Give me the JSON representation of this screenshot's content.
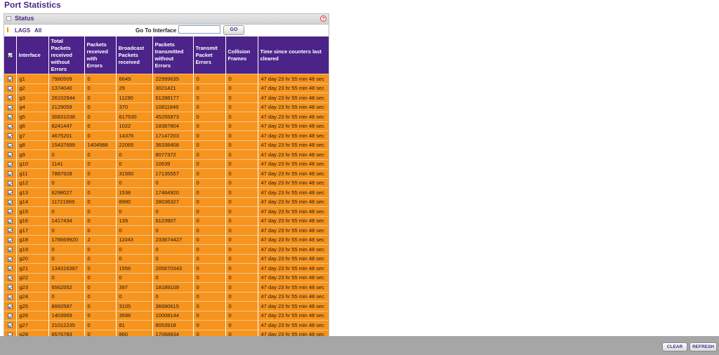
{
  "page": {
    "title": "Port Statistics"
  },
  "panel": {
    "title": "Status",
    "help_symbol": "?"
  },
  "filter": {
    "lags_label": "LAGS",
    "all_label": "All",
    "goto_label": "Go To Interface",
    "goto_value": "",
    "go_button": "GO"
  },
  "table": {
    "columns": [
      "Interface",
      "Total Packets received without Errors",
      "Packets received with Errors",
      "Broadcast Packets received",
      "Packets transmitted without Errors",
      "Transmit Packet Errors",
      "Collision Frames",
      "Time since counters last cleared"
    ],
    "rows": [
      [
        "g1",
        "7980509",
        "0",
        "6649",
        "22999635",
        "0",
        "0",
        "47 day 23 hr 55 min 48 sec"
      ],
      [
        "g2",
        "1374040",
        "0",
        "29",
        "3021421",
        "0",
        "0",
        "47 day 23 hr 55 min 48 sec"
      ],
      [
        "g3",
        "26102944",
        "0",
        "11290",
        "61288177",
        "0",
        "0",
        "47 day 23 hr 55 min 48 sec"
      ],
      [
        "g4",
        "2129059",
        "0",
        "370",
        "10811849",
        "0",
        "0",
        "47 day 23 hr 55 min 48 sec"
      ],
      [
        "g5",
        "30831038",
        "0",
        "617530",
        "45255873",
        "0",
        "0",
        "47 day 23 hr 55 min 48 sec"
      ],
      [
        "g6",
        "8241447",
        "0",
        "1022",
        "18387804",
        "0",
        "0",
        "47 day 23 hr 55 min 48 sec"
      ],
      [
        "g7",
        "4675201",
        "0",
        "14376",
        "17147203",
        "0",
        "0",
        "47 day 23 hr 55 min 48 sec"
      ],
      [
        "g8",
        "15437699",
        "1404988",
        "22065",
        "36338408",
        "0",
        "0",
        "47 day 23 hr 55 min 48 sec"
      ],
      [
        "g9",
        "0",
        "0",
        "0",
        "8077372",
        "0",
        "0",
        "47 day 23 hr 55 min 48 sec"
      ],
      [
        "g10",
        "1141",
        "0",
        "0",
        "10639",
        "0",
        "0",
        "47 day 23 hr 55 min 48 sec"
      ],
      [
        "g11",
        "7887928",
        "0",
        "31560",
        "17135557",
        "0",
        "0",
        "47 day 23 hr 55 min 48 sec"
      ],
      [
        "g12",
        "0",
        "0",
        "0",
        "0",
        "0",
        "0",
        "47 day 23 hr 55 min 48 sec"
      ],
      [
        "g13",
        "6298027",
        "0",
        "1538",
        "17484920",
        "0",
        "0",
        "47 day 23 hr 55 min 48 sec"
      ],
      [
        "g14",
        "11721969",
        "0",
        "8990",
        "28036327",
        "0",
        "0",
        "47 day 23 hr 55 min 48 sec"
      ],
      [
        "g15",
        "0",
        "0",
        "0",
        "0",
        "0",
        "0",
        "47 day 23 hr 55 min 48 sec"
      ],
      [
        "g16",
        "1417434",
        "0",
        "139",
        "6123907",
        "0",
        "0",
        "47 day 23 hr 55 min 48 sec"
      ],
      [
        "g17",
        "0",
        "0",
        "0",
        "0",
        "0",
        "0",
        "47 day 23 hr 55 min 48 sec"
      ],
      [
        "g18",
        "178669920",
        "2",
        "11043",
        "233674427",
        "0",
        "0",
        "47 day 23 hr 55 min 48 sec"
      ],
      [
        "g19",
        "0",
        "0",
        "0",
        "0",
        "0",
        "0",
        "47 day 23 hr 55 min 48 sec"
      ],
      [
        "g20",
        "0",
        "0",
        "0",
        "0",
        "0",
        "0",
        "47 day 23 hr 55 min 48 sec"
      ],
      [
        "g21",
        "134316387",
        "0",
        "1556",
        "205670343",
        "0",
        "0",
        "47 day 23 hr 55 min 48 sec"
      ],
      [
        "g22",
        "0",
        "0",
        "0",
        "0",
        "0",
        "0",
        "47 day 23 hr 55 min 48 sec"
      ],
      [
        "g23",
        "6562552",
        "0",
        "397",
        "18189109",
        "0",
        "0",
        "47 day 23 hr 55 min 48 sec"
      ],
      [
        "g24",
        "0",
        "0",
        "0",
        "0",
        "0",
        "0",
        "47 day 23 hr 55 min 48 sec"
      ],
      [
        "g25",
        "8992587",
        "0",
        "3105",
        "36690615",
        "0",
        "0",
        "47 day 23 hr 55 min 48 sec"
      ],
      [
        "g26",
        "1403969",
        "0",
        "3598",
        "10008144",
        "0",
        "0",
        "47 day 23 hr 55 min 48 sec"
      ],
      [
        "g27",
        "21012235",
        "0",
        "81",
        "8053918",
        "0",
        "0",
        "47 day 23 hr 55 min 48 sec"
      ],
      [
        "g28",
        "6576783",
        "0",
        "860",
        "17068834",
        "0",
        "0",
        "47 day 23 hr 55 min 48 sec"
      ]
    ]
  },
  "footer": {
    "clear_label": "CLEAR",
    "refresh_label": "REFRESH"
  },
  "colors": {
    "header_bg": "#4b2389",
    "row_bg": "#f7941d",
    "title": "#4a2a84",
    "footer_bg": "#a6a6a6"
  }
}
